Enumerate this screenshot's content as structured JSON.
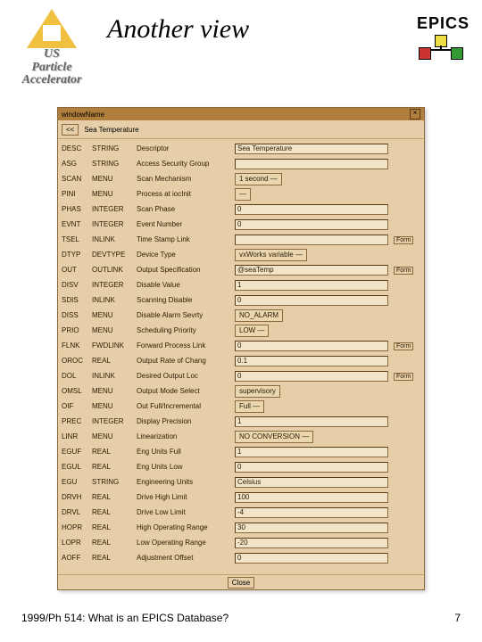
{
  "header": {
    "left_logo": {
      "l1": "US",
      "l2": "Particle",
      "l3": "Accelerator"
    },
    "title": "Another view",
    "epics": "EPICS"
  },
  "window": {
    "title": "windowName",
    "close": "×",
    "toprow": {
      "left": "<<",
      "name": "Sea Temperature"
    },
    "bottom": {
      "close": "Close"
    }
  },
  "fields": [
    {
      "n": "DESC",
      "t": "STRING",
      "d": "Descriptor",
      "v": "Sea Temperature",
      "k": "input",
      "f": ""
    },
    {
      "n": "ASG",
      "t": "STRING",
      "d": "Access Security Group",
      "v": "",
      "k": "input",
      "f": ""
    },
    {
      "n": "SCAN",
      "t": "MENU",
      "d": "Scan Mechanism",
      "v": "1 second  —",
      "k": "menu",
      "f": ""
    },
    {
      "n": "PINI",
      "t": "MENU",
      "d": "Process at iocInit",
      "v": "—",
      "k": "menu",
      "f": ""
    },
    {
      "n": "PHAS",
      "t": "INTEGER",
      "d": "Scan Phase",
      "v": "0",
      "k": "input",
      "f": ""
    },
    {
      "n": "EVNT",
      "t": "INTEGER",
      "d": "Event Number",
      "v": "0",
      "k": "input",
      "f": ""
    },
    {
      "n": "TSEL",
      "t": "INLINK",
      "d": "Time Stamp Link",
      "v": "",
      "k": "input",
      "f": "Form"
    },
    {
      "n": "DTYP",
      "t": "DEVTYPE",
      "d": "Device Type",
      "v": "vxWorks variable  —",
      "k": "menu",
      "f": ""
    },
    {
      "n": "OUT",
      "t": "OUTLINK",
      "d": "Output Specification",
      "v": "@seaTemp",
      "k": "input",
      "f": "Form"
    },
    {
      "n": "DISV",
      "t": "INTEGER",
      "d": "Disable Value",
      "v": "1",
      "k": "input",
      "f": ""
    },
    {
      "n": "SDIS",
      "t": "INLINK",
      "d": "Scanning Disable",
      "v": "0",
      "k": "input",
      "f": ""
    },
    {
      "n": "DISS",
      "t": "MENU",
      "d": "Disable Alarm Sevrty",
      "v": "NO_ALARM",
      "k": "menu",
      "f": ""
    },
    {
      "n": "PRIO",
      "t": "MENU",
      "d": "Scheduling Priority",
      "v": "LOW  —",
      "k": "menu",
      "f": ""
    },
    {
      "n": "FLNK",
      "t": "FWDLINK",
      "d": "Forward Process Link",
      "v": "0",
      "k": "input",
      "f": "Form"
    },
    {
      "n": "OROC",
      "t": "REAL",
      "d": "Output Rate of Chang",
      "v": "0.1",
      "k": "input",
      "f": ""
    },
    {
      "n": "DOL",
      "t": "INLINK",
      "d": "Desired Output Loc",
      "v": "0",
      "k": "input",
      "f": "Form"
    },
    {
      "n": "OMSL",
      "t": "MENU",
      "d": "Output Mode Select",
      "v": "supervisory",
      "k": "menu",
      "f": ""
    },
    {
      "n": "OIF",
      "t": "MENU",
      "d": "Out Full/Incremental",
      "v": "Full  —",
      "k": "menu",
      "f": ""
    },
    {
      "n": "PREC",
      "t": "INTEGER",
      "d": "Display Precision",
      "v": "1",
      "k": "input",
      "f": ""
    },
    {
      "n": "LINR",
      "t": "MENU",
      "d": "Linearization",
      "v": "NO CONVERSION   —",
      "k": "menu",
      "f": ""
    },
    {
      "n": "EGUF",
      "t": "REAL",
      "d": "Eng Units Full",
      "v": "1",
      "k": "input",
      "f": ""
    },
    {
      "n": "EGUL",
      "t": "REAL",
      "d": "Eng Units Low",
      "v": "0",
      "k": "input",
      "f": ""
    },
    {
      "n": "EGU",
      "t": "STRING",
      "d": "Engineering Units",
      "v": "Celsius",
      "k": "input",
      "f": ""
    },
    {
      "n": "DRVH",
      "t": "REAL",
      "d": "Drive High Limit",
      "v": "100",
      "k": "input",
      "f": ""
    },
    {
      "n": "DRVL",
      "t": "REAL",
      "d": "Drive Low Limit",
      "v": "-4",
      "k": "input",
      "f": ""
    },
    {
      "n": "HOPR",
      "t": "REAL",
      "d": "High Operating Range",
      "v": "30",
      "k": "input",
      "f": ""
    },
    {
      "n": "LOPR",
      "t": "REAL",
      "d": "Low Operating Range",
      "v": "-20",
      "k": "input",
      "f": ""
    },
    {
      "n": "AOFF",
      "t": "REAL",
      "d": "Adjustment Offset",
      "v": "0",
      "k": "input",
      "f": ""
    }
  ],
  "footer": {
    "left": "1999/Ph 514: What is an EPICS Database?",
    "right": "7"
  }
}
